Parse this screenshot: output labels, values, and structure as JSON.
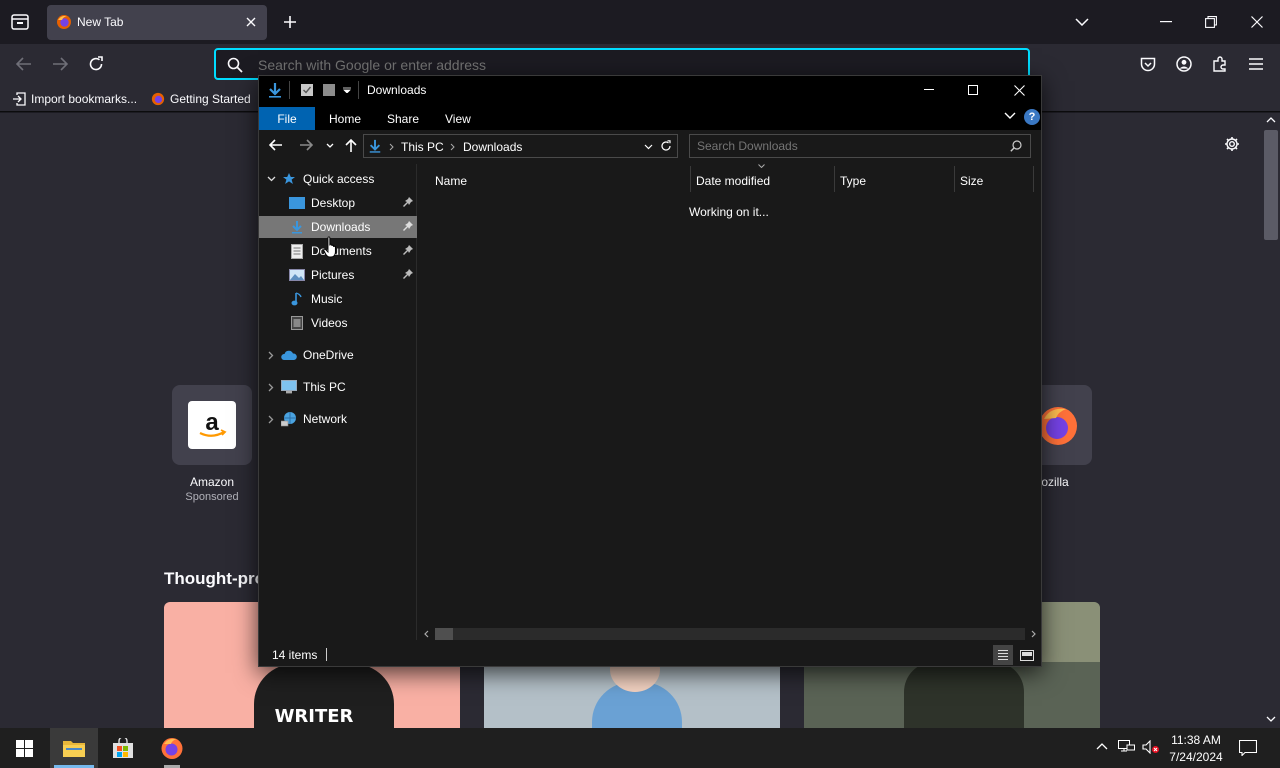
{
  "browser": {
    "tab_title": "New Tab",
    "url_placeholder": "Search with Google or enter address",
    "bookmarks": [
      {
        "label": "Import bookmarks..."
      },
      {
        "label": "Getting Started"
      }
    ]
  },
  "newtab": {
    "tiles": [
      {
        "label": "Amazon",
        "sub": "Sponsored"
      },
      {
        "label": "ozilla"
      }
    ],
    "section_heading": "Thought-pro",
    "card_text": "WRITER"
  },
  "explorer": {
    "title": "Downloads",
    "ribbon_tabs": [
      "File",
      "Home",
      "Share",
      "View"
    ],
    "breadcrumb": [
      "This PC",
      "Downloads"
    ],
    "search_placeholder": "Search Downloads",
    "nav": {
      "quick_access": "Quick access",
      "items": [
        {
          "label": "Desktop"
        },
        {
          "label": "Downloads"
        },
        {
          "label": "Documents"
        },
        {
          "label": "Pictures"
        },
        {
          "label": "Music"
        },
        {
          "label": "Videos"
        }
      ],
      "onedrive": "OneDrive",
      "this_pc": "This PC",
      "network": "Network"
    },
    "columns": [
      "Name",
      "Date modified",
      "Type",
      "Size"
    ],
    "loading_text": "Working on it...",
    "status": "14 items"
  },
  "taskbar": {
    "time": "11:38 AM",
    "date": "7/24/2024"
  },
  "colors": {
    "accent": "#00ddff",
    "file_tab": "#0063b1",
    "selected_nav": "#777777"
  }
}
